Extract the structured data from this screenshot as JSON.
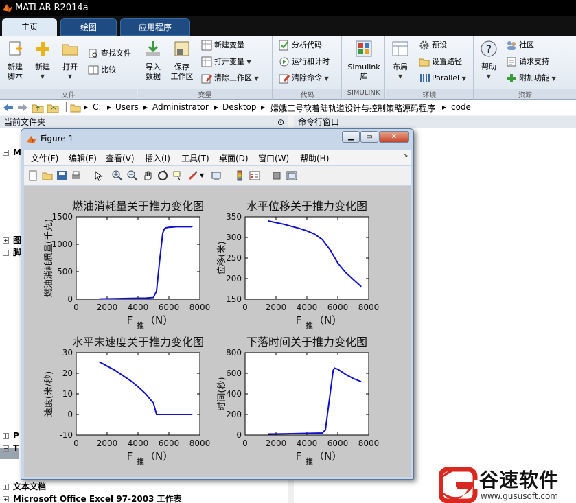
{
  "window": {
    "title": "MATLAB R2014a"
  },
  "tabs": [
    {
      "label": "主页",
      "active": true
    },
    {
      "label": "绘图",
      "active": false
    },
    {
      "label": "应用程序",
      "active": false
    }
  ],
  "ribbon": {
    "file_group": {
      "label": "文件",
      "new_script": "新建\n脚本",
      "new": "新建",
      "open": "打开",
      "find_files": "查找文件",
      "compare": "比较"
    },
    "variable_group": {
      "label": "变量",
      "import": "导入\n数据",
      "save_ws": "保存\n工作区",
      "new_var": "新建变量",
      "open_var": "打开变量",
      "clear_ws": "清除工作区"
    },
    "code_group": {
      "label": "代码",
      "analyze": "分析代码",
      "run_time": "运行和计时",
      "clear_cmd": "清除命令"
    },
    "simulink_group": {
      "label": "SIMULINK",
      "library": "Simulink\n库"
    },
    "env_group": {
      "label": "环境",
      "layout": "布局",
      "prefs": "预设",
      "set_path": "设置路径",
      "parallel": "Parallel"
    },
    "resources_group": {
      "label": "资源",
      "help": "帮助",
      "community": "社区",
      "request_support": "请求支持",
      "addons": "附加功能"
    }
  },
  "address": {
    "segments": [
      "C:",
      "Users",
      "Administrator",
      "Desktop",
      "嫦娥三号软着陆轨道设计与控制策略源码程序",
      "code"
    ]
  },
  "panels": {
    "current_folder": "当前文件夹",
    "command_window": "命令行窗口"
  },
  "tree": {
    "row1": "M",
    "row2": "图",
    "row3": "脚",
    "row4": "P",
    "row5": "T",
    "text_docs": "文本文档",
    "excel": "Microsoft Office Excel 97-2003 工作表"
  },
  "figure": {
    "title": "Figure 1",
    "menu": [
      "文件(F)",
      "编辑(E)",
      "查看(V)",
      "插入(I)",
      "工具(T)",
      "桌面(D)",
      "窗口(W)",
      "帮助(H)"
    ],
    "subplots": [
      {
        "title": "燃油消耗量关于推力变化图",
        "ylabel": "燃油消耗质量(千克)",
        "xlabel_main": "F",
        "xlabel_sub": "推",
        "xlabel_unit": "（N）"
      },
      {
        "title": "水平位移关于推力变化图",
        "ylabel": "位移(米)",
        "xlabel_main": "F",
        "xlabel_sub": "推",
        "xlabel_unit": "（N）"
      },
      {
        "title": "水平末速度关于推力变化图",
        "ylabel": "速度(米/秒)",
        "xlabel_main": "F",
        "xlabel_sub": "推",
        "xlabel_unit": "（N）"
      },
      {
        "title": "下落时间关于推力变化图",
        "ylabel": "时间(秒)",
        "xlabel_main": "F",
        "xlabel_sub": "推",
        "xlabel_unit": "（N）"
      }
    ]
  },
  "watermark": {
    "brand": "谷速软件",
    "url": "www.gususoft.com"
  },
  "chart_data": [
    {
      "type": "line",
      "xlim": [
        0,
        8000
      ],
      "ylim": [
        0,
        1500
      ],
      "xticks": [
        0,
        2000,
        4000,
        6000,
        8000
      ],
      "yticks": [
        0,
        500,
        1000,
        1500
      ],
      "x": [
        1500,
        2500,
        3500,
        4500,
        5000,
        5200,
        5400,
        5600,
        5700,
        5800,
        6000,
        6500,
        7000,
        7500
      ],
      "values": [
        5,
        10,
        15,
        20,
        30,
        150,
        700,
        1200,
        1280,
        1300,
        1310,
        1320,
        1320,
        1320
      ]
    },
    {
      "type": "line",
      "xlim": [
        0,
        8000
      ],
      "ylim": [
        150,
        350
      ],
      "xticks": [
        0,
        2000,
        4000,
        6000,
        8000
      ],
      "yticks": [
        150,
        200,
        250,
        300,
        350
      ],
      "x": [
        1500,
        2000,
        2500,
        3000,
        3500,
        4000,
        4500,
        5000,
        5500,
        6000,
        6500,
        7000,
        7500
      ],
      "values": [
        340,
        336,
        332,
        327,
        322,
        316,
        308,
        295,
        270,
        238,
        215,
        198,
        181
      ]
    },
    {
      "type": "line",
      "xlim": [
        0,
        8000
      ],
      "ylim": [
        -10,
        30
      ],
      "xticks": [
        0,
        2000,
        4000,
        6000,
        8000
      ],
      "yticks": [
        -10,
        0,
        10,
        20,
        30
      ],
      "x": [
        1500,
        2000,
        2500,
        3000,
        3500,
        4000,
        4500,
        5000,
        5200,
        6000,
        7000,
        7500
      ],
      "values": [
        25.5,
        23.5,
        21.5,
        19,
        16.5,
        13.5,
        10,
        5.5,
        0,
        0,
        0,
        0
      ]
    },
    {
      "type": "line",
      "xlim": [
        0,
        8000
      ],
      "ylim": [
        0,
        800
      ],
      "xticks": [
        0,
        2000,
        4000,
        6000,
        8000
      ],
      "yticks": [
        0,
        200,
        400,
        600,
        800
      ],
      "x": [
        1500,
        2500,
        3500,
        4500,
        5000,
        5200,
        5500,
        5700,
        5800,
        6000,
        6500,
        7000,
        7500
      ],
      "values": [
        10,
        12,
        15,
        18,
        20,
        50,
        400,
        630,
        650,
        640,
        590,
        550,
        520
      ]
    }
  ]
}
